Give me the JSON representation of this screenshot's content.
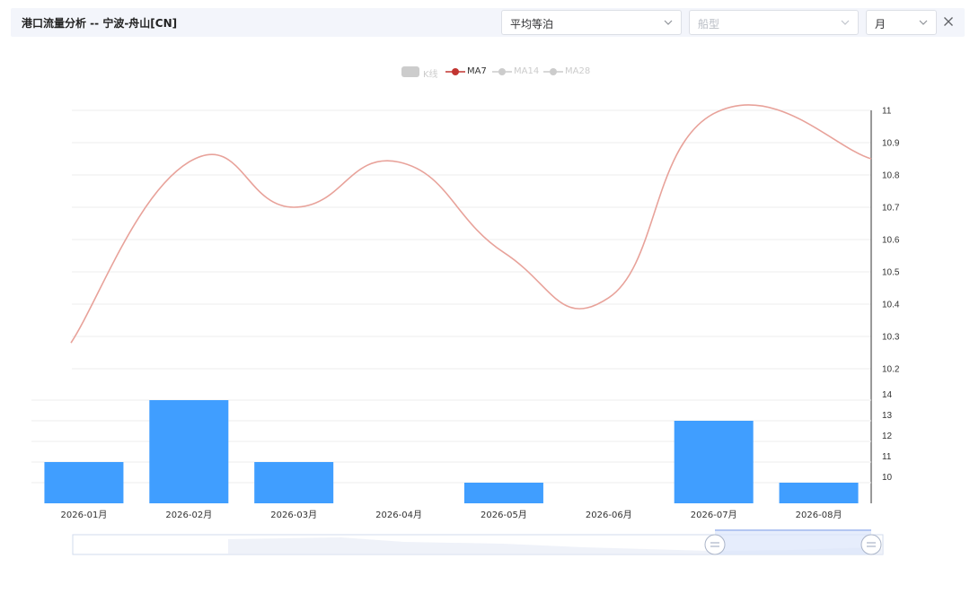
{
  "header": {
    "title": "港口流量分析 -- 宁波-舟山[CN]",
    "metric_select": "平均等泊",
    "ship_type_placeholder": "船型",
    "period_select": "月"
  },
  "legend": [
    {
      "name": "K线",
      "active": false
    },
    {
      "name": "MA7",
      "active": true
    },
    {
      "name": "MA14",
      "active": false
    },
    {
      "name": "MA28",
      "active": false
    }
  ],
  "colors": {
    "bar": "#409eff",
    "ma7_line": "#e8a29a",
    "ma7_legend": "#c23531",
    "inactive": "#cccccc",
    "grid": "#eeeeee"
  },
  "chart_data": {
    "type": "bar",
    "categories": [
      "2026-01月",
      "2026-02月",
      "2026-03月",
      "2026-04月",
      "2026-05月",
      "2026-06月",
      "2026-07月",
      "2026-08月"
    ],
    "line_series": {
      "name": "MA7",
      "values": [
        10.28,
        10.84,
        10.7,
        10.84,
        10.56,
        10.42,
        10.99,
        10.85
      ]
    },
    "bar_series": {
      "values": [
        11,
        14,
        11,
        null,
        10,
        null,
        13,
        10
      ]
    },
    "top_y_ticks": [
      "10.2",
      "10.3",
      "10.4",
      "10.5",
      "10.6",
      "10.7",
      "10.8",
      "10.9",
      "11"
    ],
    "top_ylim": [
      10.2,
      11
    ],
    "bottom_y_ticks": [
      "10",
      "11",
      "12",
      "13",
      "14"
    ],
    "bottom_ylim": [
      9,
      14
    ],
    "grid": true,
    "legend_position": "top-center"
  }
}
